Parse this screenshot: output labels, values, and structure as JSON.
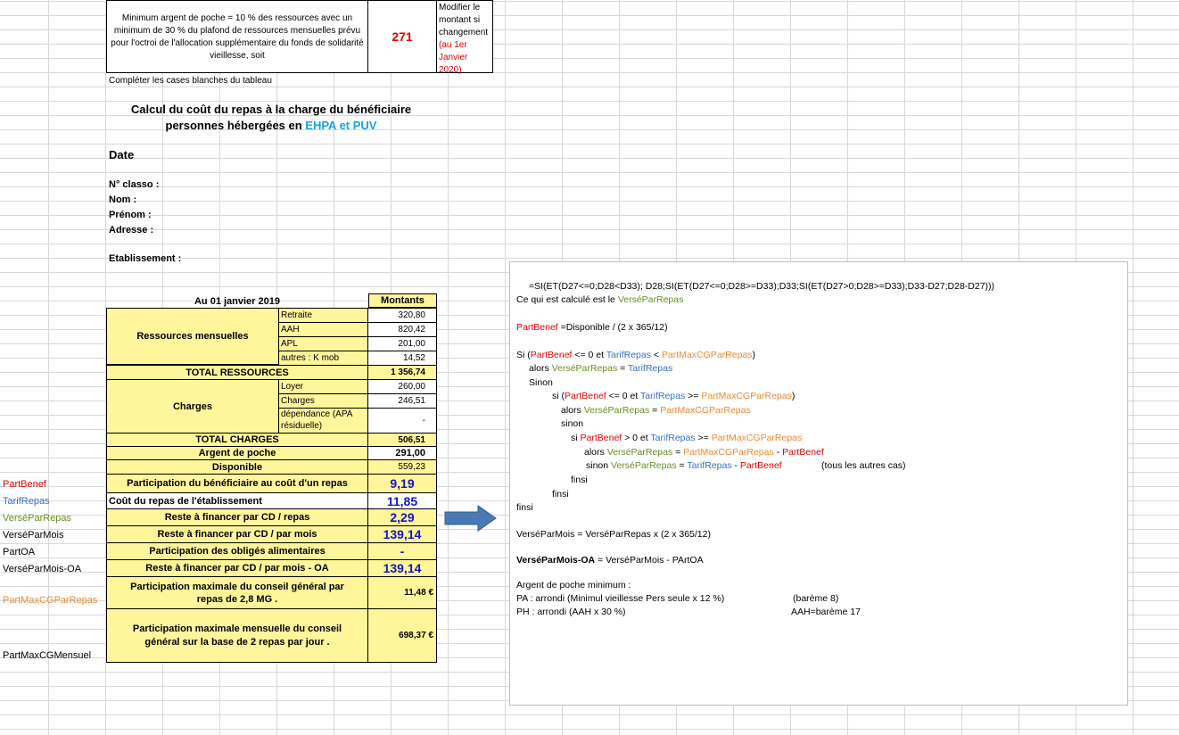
{
  "note_box": {
    "text": "Minimum argent de poche = 10 % des ressources avec un minimum de 30 % du plafond de ressources mensuelles prévu pour l'octroi de l'allocation supplémentaire du fonds de solidarité vieillesse, soit",
    "value": "271",
    "modify_line1": "Modifier le montant si changement",
    "modify_line2": "(au 1er Janvier 2020)"
  },
  "instruction": "Compléter les cases blanches du tableau",
  "title": {
    "line1": "Calcul du coût du repas à la charge du bénéficiaire",
    "line2_prefix": "personnes hébergées en ",
    "line2_highlight": "EHPA et PUV"
  },
  "fields": {
    "date": "Date",
    "classo": "N° classo :",
    "nom": "Nom :",
    "prenom": "Prénom :",
    "adresse": "Adresse :",
    "etablissement": "Etablissement :"
  },
  "table": {
    "header_date": "Au 01 janvier 2019",
    "header_amounts": "Montants",
    "ressources_label": "Ressources mensuelles",
    "ressources": [
      {
        "label": "Retraite",
        "value": "320,80"
      },
      {
        "label": "AAH",
        "value": "820,42"
      },
      {
        "label": "APL",
        "value": "201,00"
      },
      {
        "label": "autres : K mob",
        "value": "14,52"
      }
    ],
    "total_ressources_label": "TOTAL RESSOURCES",
    "total_ressources_value": "1 356,74",
    "charges_label": "Charges",
    "charges": [
      {
        "label": "Loyer",
        "value": "260,00"
      },
      {
        "label": "Charges",
        "value": "246,51"
      },
      {
        "label": "dépendance (APA résiduelle)",
        "value": "-"
      }
    ],
    "total_charges_label": "TOTAL CHARGES",
    "total_charges_value": "506,51",
    "argent_poche_label": "Argent de poche",
    "argent_poche_value": "291,00",
    "disponible_label": "Disponible",
    "disponible_value": "559,23",
    "participation_label": "Participation du bénéficiaire au coût d'un repas",
    "participation_value": "9,19",
    "cout_repas_label": "Coût du repas de l'établissement",
    "cout_repas_value": "11,85",
    "reste_repas_label": "Reste à financer par CD / repas",
    "reste_repas_value": "2,29",
    "reste_mois_label": "Reste à financer par CD / par mois",
    "reste_mois_value": "139,14",
    "oblige_label": "Participation des obligés alimentaires",
    "oblige_value": "-",
    "reste_mois_oa_label": "Reste à financer par CD / par mois - OA",
    "reste_mois_oa_value": "139,14",
    "max_repas_label": "Participation maximale du conseil général par repas de 2,8 MG .",
    "max_repas_value": "11,48 €",
    "max_mensuel_label": "Participation maximale mensuelle du conseil général sur la base de 2 repas par jour .",
    "max_mensuel_value": "698,37 €"
  },
  "side_labels": {
    "partbenef": "PartBenef",
    "tarifrepas": "TarifRepas",
    "verseparrepas": "VerséParRepas",
    "versepmois": "VerséParMois",
    "partoa": "PartOA",
    "versepmoisoa": "VerséParMois-OA",
    "partmaxrepas": "PartMaxCGParRepas",
    "partmaxmensuel": "PartMaxCGMensuel"
  },
  "popup": {
    "formula": "=SI(ET(D27<=0;D28<D33); D28;SI(ET(D27<=0;D28>=D33);D33;SI(ET(D27>0;D28>=D33);D33-D27;D28-D27)))",
    "calc_prefix": "Ce qui est calculé est le ",
    "calc_var": "VerséParRepas",
    "partbenef": "PartBenef",
    "partbenef_def": " =Disponible / (2 x 365/12)",
    "si": "Si (",
    "tarif": "TarifRepas",
    "partmax": "PartMaxCGParRepas",
    "verse": "VerséParRepas",
    "le0et": " <= 0 et ",
    "gt0et": " > 0 et ",
    "lt": " < ",
    "ge": " >= ",
    "eq": " = ",
    "minus": " - ",
    "close": ")",
    "alors": "alors ",
    "sinon_cap": "Sinon",
    "si_low": "si (",
    "si_low2": "si ",
    "sinon_low": "sinon",
    "sinon_sp": "sinon ",
    "autres": "(tous les autres cas)",
    "finsi": "finsi",
    "versemois_line": "VerséParMois = VerséParRepas x (2 x 365/12)",
    "versemoisoa_bold": "VerséParMois-OA",
    "versemoisoa_rest": " = VerséParMois - PArtOA",
    "argent_title": "Argent de poche minimum :",
    "pa_line": "PA : arrondi (Minimul vieillesse Pers seule x 12 %)",
    "pa_bareme": "(barème 8)",
    "ph_line": "PH : arrondi (AAH x 30 %)",
    "ph_bareme": "AAH=barème 17"
  },
  "colors": {
    "cell_fill": "#fff59a",
    "red": "#e00000",
    "blue": "#1414c8",
    "cyan": "#1aa3e0",
    "var_blue": "#3b6fbf",
    "var_green": "#6b8e23",
    "var_orange": "#ed8a30",
    "arrow": "#4a7ab5"
  }
}
